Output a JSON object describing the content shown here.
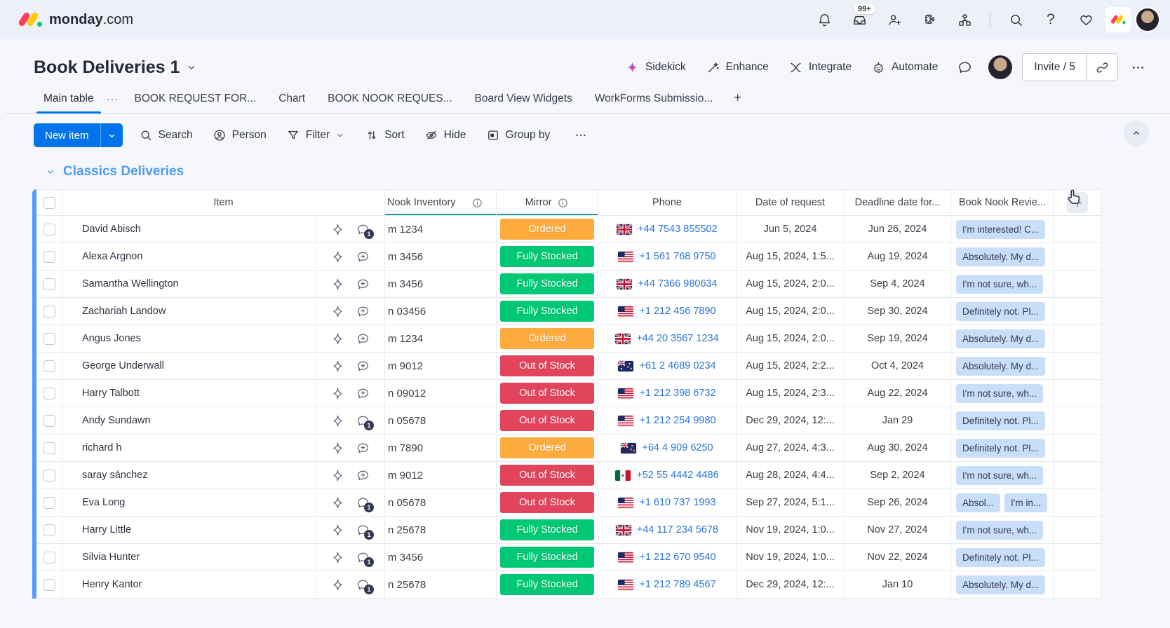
{
  "topbar": {
    "logo_bold": "monday",
    "logo_light": ".com",
    "inbox_badge": "99+",
    "icons": [
      {
        "icon": "bell-icon"
      },
      {
        "icon": "inbox-icon",
        "badge": "99+"
      },
      {
        "icon": "invite-members-icon"
      },
      {
        "icon": "apps-marketplace-icon"
      },
      {
        "icon": "products-switcher-icon"
      },
      {
        "divider": true
      },
      {
        "icon": "search-icon"
      },
      {
        "icon": "help-icon"
      },
      {
        "icon": "whats-new-heart-icon"
      }
    ]
  },
  "board_header": {
    "title": "Book Deliveries 1",
    "actions": [
      {
        "icon": "sidekick-sparkle-icon",
        "label": "Sidekick"
      },
      {
        "icon": "enhance-wand-icon",
        "label": "Enhance"
      },
      {
        "icon": "integrate-icon",
        "label": "Integrate"
      },
      {
        "icon": "automate-robot-icon",
        "label": "Automate"
      }
    ],
    "invite_label": "Invite / 5",
    "menu_icon": "ellipsis-icon"
  },
  "tabs": {
    "active": "Main table",
    "items": [
      "Main table",
      "BOOK REQUEST FOR...",
      "Chart",
      "BOOK NOOK REQUES...",
      "Board View Widgets",
      "WorkForms Submissio..."
    ],
    "add_label": "+"
  },
  "toolbar": {
    "new_item_label": "New item",
    "actions": [
      {
        "icon": "search-icon",
        "label": "Search"
      },
      {
        "icon": "person-icon",
        "label": "Person"
      },
      {
        "icon": "filter-icon",
        "label": "Filter",
        "chevron": true
      },
      {
        "icon": "sort-icon",
        "label": "Sort"
      },
      {
        "icon": "hide-icon",
        "label": "Hide"
      },
      {
        "icon": "groupby-icon",
        "label": "Group by"
      }
    ]
  },
  "group": {
    "title": "Classics Deliveries",
    "color": "#4f9bf2"
  },
  "table": {
    "headers": {
      "item": "Item",
      "inventory": "Nook Inventory",
      "mirror": "Mirror",
      "phone": "Phone",
      "date_request": "Date of request",
      "deadline": "Deadline date for...",
      "review": "Book Nook Revie..."
    },
    "status_colors": {
      "Ordered": "#fdab3d",
      "Fully Stocked": "#00c875",
      "Out of Stock": "#e2445c"
    },
    "rows": [
      {
        "name": "David Abisch",
        "chat_badge": 1,
        "inventory": "m 1234",
        "status": "Ordered",
        "flag": "gb",
        "phone": "+44 7543 855502",
        "requested": "Jun 5, 2024",
        "deadline": "Jun 26, 2024",
        "reviews": [
          "I'm interested! C..."
        ]
      },
      {
        "name": "Alexa Argnon",
        "chat_badge": null,
        "inventory": "m 3456",
        "status": "Fully Stocked",
        "flag": "us",
        "phone": "+1 561 768 9750",
        "requested": "Aug 15, 2024, 1:5...",
        "deadline": "Aug 19, 2024",
        "reviews": [
          "Absolutely. My d..."
        ]
      },
      {
        "name": "Samantha Wellington",
        "chat_badge": null,
        "inventory": "m 3456",
        "status": "Fully Stocked",
        "flag": "gb",
        "phone": "+44 7366 980634",
        "requested": "Aug 15, 2024, 2:0...",
        "deadline": "Sep 4, 2024",
        "reviews": [
          "I'm not sure, wh..."
        ]
      },
      {
        "name": "Zachariah Landow",
        "chat_badge": null,
        "inventory": "n 03456",
        "status": "Fully Stocked",
        "flag": "us",
        "phone": "+1 212 456 7890",
        "requested": "Aug 15, 2024, 2:0...",
        "deadline": "Sep 30, 2024",
        "reviews": [
          "Definitely not. Pl..."
        ]
      },
      {
        "name": "Angus Jones",
        "chat_badge": null,
        "inventory": "m 1234",
        "status": "Ordered",
        "flag": "gb",
        "phone": "+44 20 3567 1234",
        "requested": "Aug 15, 2024, 2:0...",
        "deadline": "Sep 19, 2024",
        "reviews": [
          "Absolutely. My d..."
        ]
      },
      {
        "name": "George Underwall",
        "chat_badge": null,
        "inventory": "m 9012",
        "status": "Out of Stock",
        "flag": "au",
        "phone": "+61 2 4689 0234",
        "requested": "Aug 15, 2024, 2:2...",
        "deadline": "Oct 4, 2024",
        "reviews": [
          "Absolutely. My d..."
        ]
      },
      {
        "name": "Harry Talbott",
        "chat_badge": null,
        "inventory": "n 09012",
        "status": "Out of Stock",
        "flag": "us",
        "phone": "+1 212 398 6732",
        "requested": "Aug 15, 2024, 2:3...",
        "deadline": "Aug 22, 2024",
        "reviews": [
          "I'm not sure, wh..."
        ]
      },
      {
        "name": "Andy Sundawn",
        "chat_badge": 1,
        "inventory": "n 05678",
        "status": "Out of Stock",
        "flag": "us",
        "phone": "+1 212 254 9980",
        "requested": "Dec 29, 2024, 12:...",
        "deadline": "Jan 29",
        "reviews": [
          "Definitely not. Pl..."
        ]
      },
      {
        "name": "richard h",
        "chat_badge": null,
        "inventory": "m 7890",
        "status": "Ordered",
        "flag": "nz",
        "phone": "+64 4 909 6250",
        "requested": "Aug 27, 2024, 4:3...",
        "deadline": "Aug 30, 2024",
        "reviews": [
          "Definitely not. Pl..."
        ]
      },
      {
        "name": "saray sánchez",
        "chat_badge": null,
        "inventory": "m 9012",
        "status": "Out of Stock",
        "flag": "mx",
        "phone": "+52 55 4442 4486",
        "requested": "Aug 28, 2024, 4:4...",
        "deadline": "Sep 2, 2024",
        "reviews": [
          "I'm not sure, wh..."
        ]
      },
      {
        "name": "Eva Long",
        "chat_badge": 1,
        "inventory": "n 05678",
        "status": "Out of Stock",
        "flag": "us",
        "phone": "+1 610 737 1993",
        "requested": "Sep 27, 2024, 5:1...",
        "deadline": "Sep 26, 2024",
        "reviews": [
          "Absol...",
          "I'm in..."
        ]
      },
      {
        "name": "Harry Little",
        "chat_badge": 1,
        "inventory": "n 25678",
        "status": "Fully Stocked",
        "flag": "gb",
        "phone": "+44 117 234 5678",
        "requested": "Nov 19, 2024, 1:0...",
        "deadline": "Nov 27, 2024",
        "reviews": [
          "I'm not sure, wh..."
        ]
      },
      {
        "name": "Silvia Hunter",
        "chat_badge": 1,
        "inventory": "m 3456",
        "status": "Fully Stocked",
        "flag": "us",
        "phone": "+1 212 670 9540",
        "requested": "Nov 19, 2024, 1:0...",
        "deadline": "Nov 22, 2024",
        "reviews": [
          "Definitely not. Pl..."
        ]
      },
      {
        "name": "Henry Kantor",
        "chat_badge": 1,
        "inventory": "n 25678",
        "status": "Fully Stocked",
        "flag": "us",
        "phone": "+1 212 789 4567",
        "requested": "Dec 29, 2024, 12:...",
        "deadline": "Jan 10",
        "reviews": [
          "Absolutely. My d..."
        ]
      }
    ]
  }
}
